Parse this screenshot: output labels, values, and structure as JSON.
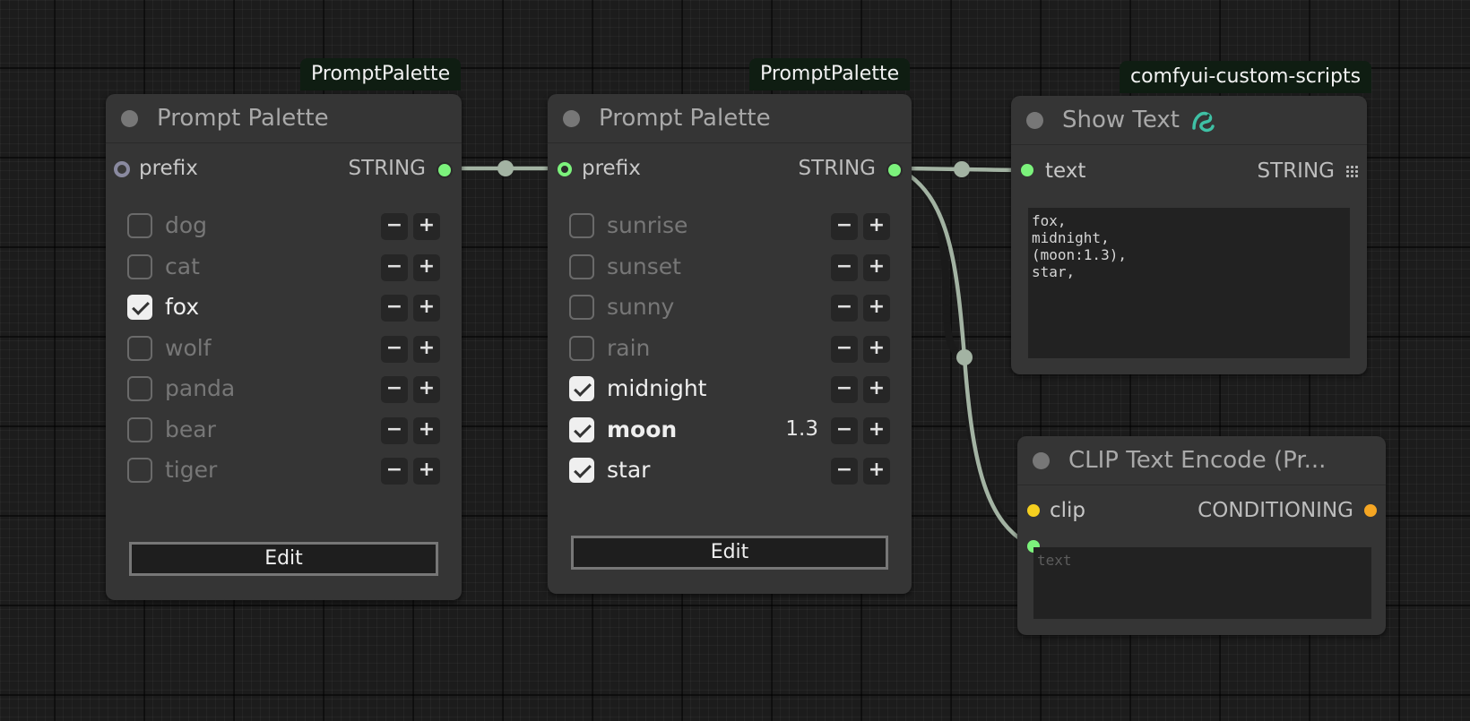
{
  "nodes": {
    "palette1": {
      "badge": "PromptPalette",
      "title": "Prompt Palette",
      "input_label": "prefix",
      "output_type": "STRING",
      "items": [
        {
          "label": "dog",
          "checked": false
        },
        {
          "label": "cat",
          "checked": false
        },
        {
          "label": "fox",
          "checked": true
        },
        {
          "label": "wolf",
          "checked": false
        },
        {
          "label": "panda",
          "checked": false
        },
        {
          "label": "bear",
          "checked": false
        },
        {
          "label": "tiger",
          "checked": false
        }
      ],
      "edit_label": "Edit"
    },
    "palette2": {
      "badge": "PromptPalette",
      "title": "Prompt Palette",
      "input_label": "prefix",
      "output_type": "STRING",
      "items": [
        {
          "label": "sunrise",
          "checked": false
        },
        {
          "label": "sunset",
          "checked": false
        },
        {
          "label": "sunny",
          "checked": false
        },
        {
          "label": "rain",
          "checked": false
        },
        {
          "label": "midnight",
          "checked": true
        },
        {
          "label": "moon",
          "checked": true,
          "weight": "1.3"
        },
        {
          "label": "star",
          "checked": true
        }
      ],
      "edit_label": "Edit"
    },
    "show_text": {
      "badge": "comfyui-custom-scripts",
      "title": "Show Text",
      "title_icon": "snake-icon",
      "input_label": "text",
      "output_type": "STRING",
      "output_icon": "grid-list-icon",
      "text_value": "fox,\nmidnight,\n(moon:1.3),\nstar,"
    },
    "clip": {
      "title": "CLIP Text Encode (Pr...",
      "input_label": "clip",
      "output_type": "CONDITIONING",
      "text_placeholder": "text"
    }
  },
  "button_glyphs": {
    "minus": "−",
    "plus": "+"
  },
  "colors": {
    "link": "#a3b3a3",
    "string_slot": "#7cf27c",
    "clip_slot": "#f5cf1f",
    "conditioning_slot": "#f5a623",
    "badge_bg": "#0f1d12",
    "node_bg": "#353535",
    "canvas_bg": "#1c1c1c"
  }
}
